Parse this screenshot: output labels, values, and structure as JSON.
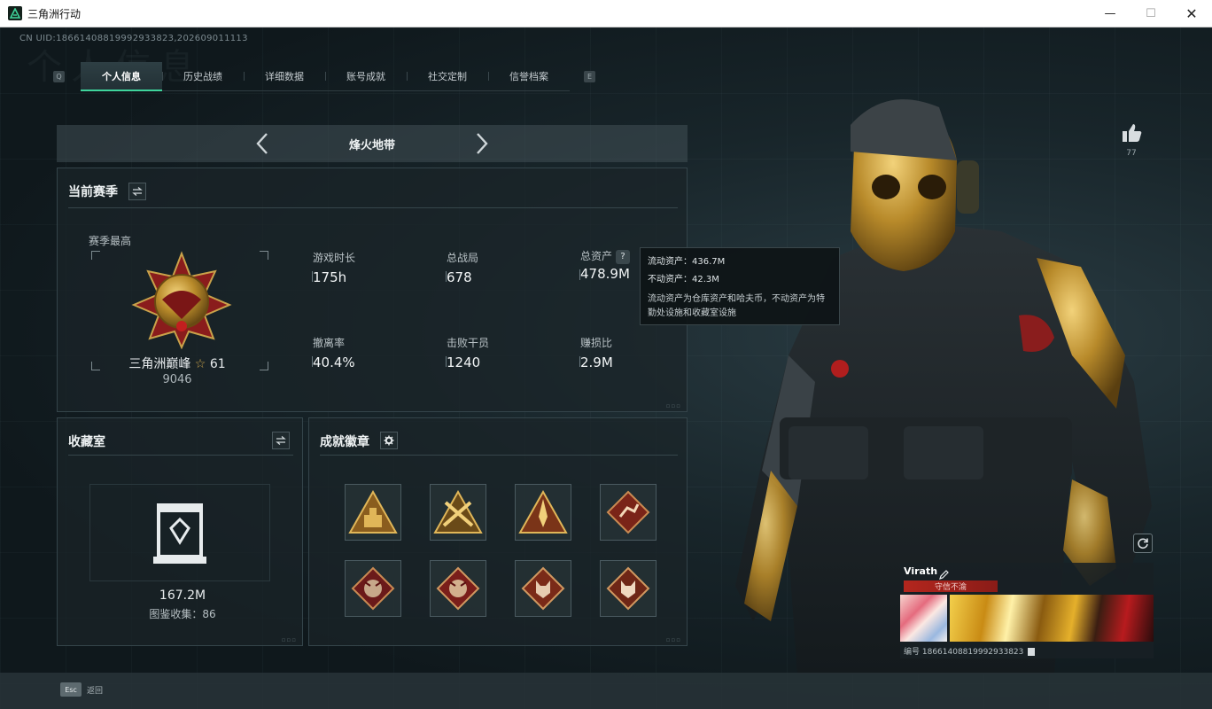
{
  "window": {
    "title": "三角洲行动",
    "minimize": "—",
    "maximize": "☐",
    "close": "✕"
  },
  "uid_text": "CN UID:18661408819992933823,202609011113",
  "watermark": "个人信息",
  "tabs": {
    "left_key": "Q",
    "right_key": "E",
    "items": [
      {
        "label": "个人信息",
        "active": true
      },
      {
        "label": "历史战绩",
        "active": false
      },
      {
        "label": "详细数据",
        "active": false
      },
      {
        "label": "账号成就",
        "active": false
      },
      {
        "label": "社交定制",
        "active": false
      },
      {
        "label": "信誉档案",
        "active": false
      }
    ]
  },
  "mode": {
    "title": "烽火地带"
  },
  "season": {
    "title": "当前赛季",
    "best_label": "赛季最高",
    "rank_name": "三角洲巅峰",
    "rank_stars": "61",
    "rank_score": "9046",
    "stats": [
      {
        "label": "游戏时长",
        "value": "175h"
      },
      {
        "label": "总战局",
        "value": "678"
      },
      {
        "label": "总资产",
        "value": "478.9M",
        "help": "?"
      },
      {
        "label": "撤离率",
        "value": "40.4%"
      },
      {
        "label": "击败干员",
        "value": "1240"
      },
      {
        "label": "赚损比",
        "value": "2.9M"
      }
    ]
  },
  "tooltip": {
    "liquid": "流动资产：436.7M",
    "fixed": "不动资产：42.3M",
    "desc": "流动资产为仓库资产和哈夫币，不动资产为特勤处设施和收藏室设施"
  },
  "collection": {
    "title": "收藏室",
    "value": "167.2M",
    "count": "图鉴收集：86"
  },
  "achievements": {
    "title": "成就徽章",
    "badges": [
      "weight-badge-icon",
      "crossed-weapons-badge-icon",
      "rocket-badge-icon",
      "runner-badge-icon",
      "dragon-badge-icon",
      "dragon-badge-icon",
      "wolf-badge-icon",
      "wolf-badge-icon"
    ]
  },
  "profile": {
    "likes": "77",
    "name": "Virath",
    "title_tag": "守信不渝",
    "id_text": "编号 18661408819992933823"
  },
  "bottom": {
    "esc_key": "Esc",
    "esc_label": "返回"
  },
  "colors": {
    "accent": "#3fd49c",
    "panel_border": "#34444a",
    "gold": "#c9a24a",
    "tag_red": "#b3261e"
  }
}
